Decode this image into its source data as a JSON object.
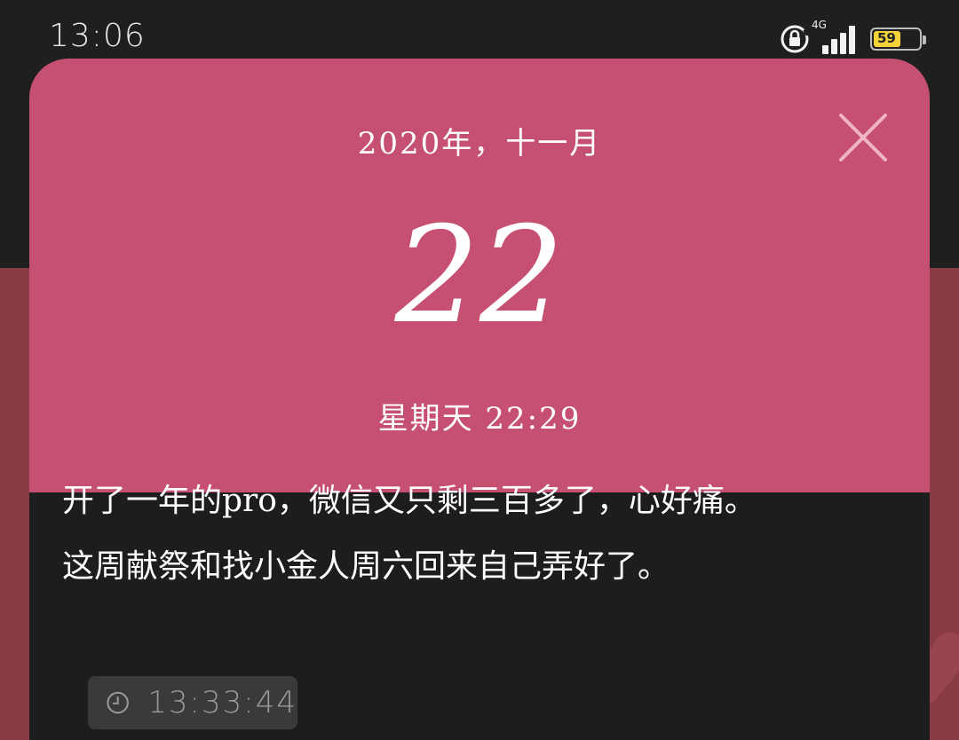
{
  "status_bar": {
    "time": "13:06",
    "network_type": "4G",
    "battery_percent": 59,
    "battery_label": "59",
    "icons": [
      "rotation-lock-icon",
      "signal-icon",
      "battery-icon"
    ]
  },
  "card": {
    "year_month": "2020年，十一月",
    "day": "22",
    "weekday_time": "星期天 22:29",
    "note_lines": [
      "开了一年的pro，微信又只剩三百多了，心好痛。",
      "这周献祭和找小金人周六回来自己弄好了。"
    ],
    "timestamp": "13:33:44",
    "close_icon": "close-icon",
    "timestamp_icon": "clock-icon"
  },
  "colors": {
    "header": "#c65071",
    "body": "#1d1d1d",
    "background_bottom": "#8a3c46",
    "timestamp_bg": "#3a3a3a",
    "battery_fill": "#f3d23a"
  }
}
